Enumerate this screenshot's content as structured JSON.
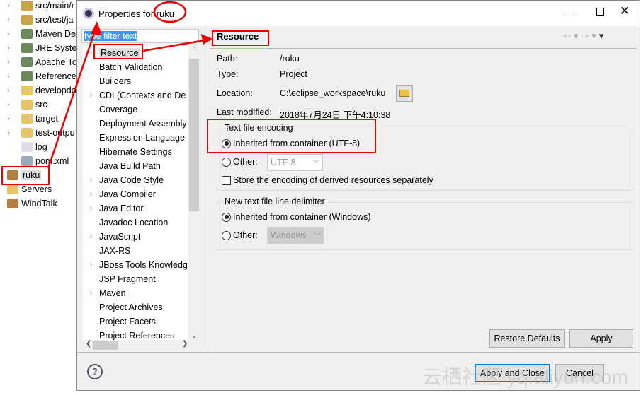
{
  "explorer": {
    "items": [
      {
        "label": "src/main/r",
        "chev": true,
        "icon": "package-folder-icon"
      },
      {
        "label": "src/test/ja",
        "chev": true,
        "icon": "package-folder-icon"
      },
      {
        "label": "Maven De",
        "chev": true,
        "icon": "library-icon"
      },
      {
        "label": "JRE Syster",
        "chev": true,
        "icon": "library-icon"
      },
      {
        "label": "Apache To",
        "chev": true,
        "icon": "library-icon"
      },
      {
        "label": "Reference",
        "chev": true,
        "icon": "library-icon"
      },
      {
        "label": "developdo",
        "chev": true,
        "icon": "folder-icon"
      },
      {
        "label": "src",
        "chev": true,
        "icon": "folder-icon"
      },
      {
        "label": "target",
        "chev": true,
        "icon": "folder-icon"
      },
      {
        "label": "test-outpu",
        "chev": true,
        "icon": "folder-icon"
      },
      {
        "label": "log",
        "chev": false,
        "icon": "file-icon"
      },
      {
        "label": "pom.xml",
        "chev": false,
        "icon": "maven-file-icon"
      }
    ],
    "projects": [
      {
        "label": "ruku",
        "icon": "project-icon"
      },
      {
        "label": "Servers",
        "icon": "folder-icon"
      },
      {
        "label": "WindTalk",
        "icon": "project-icon"
      }
    ]
  },
  "dialog": {
    "title": "Properties for ruku",
    "filter": {
      "value": "type filter text"
    },
    "tree": [
      {
        "label": "Resource",
        "chev": true,
        "selected": true
      },
      {
        "label": "Batch Validation",
        "chev": false
      },
      {
        "label": "Builders",
        "chev": false
      },
      {
        "label": "CDI (Contexts and De",
        "chev": true
      },
      {
        "label": "Coverage",
        "chev": false
      },
      {
        "label": "Deployment Assembly",
        "chev": false
      },
      {
        "label": "Expression Language",
        "chev": false
      },
      {
        "label": "Hibernate Settings",
        "chev": false
      },
      {
        "label": "Java Build Path",
        "chev": false
      },
      {
        "label": "Java Code Style",
        "chev": true
      },
      {
        "label": "Java Compiler",
        "chev": true
      },
      {
        "label": "Java Editor",
        "chev": true
      },
      {
        "label": "Javadoc Location",
        "chev": false
      },
      {
        "label": "JavaScript",
        "chev": true
      },
      {
        "label": "JAX-RS",
        "chev": false
      },
      {
        "label": "JBoss Tools Knowledg",
        "chev": true
      },
      {
        "label": "JSP Fragment",
        "chev": false
      },
      {
        "label": "Maven",
        "chev": true
      },
      {
        "label": "Project Archives",
        "chev": false
      },
      {
        "label": "Project Facets",
        "chev": false
      },
      {
        "label": "Project References",
        "chev": false
      }
    ],
    "page": {
      "heading": "Resource",
      "path_label": "Path:",
      "path": "/ruku",
      "type_label": "Type:",
      "type": "Project",
      "location_label": "Location:",
      "location": "C:\\eclipse_workspace\\ruku",
      "modified_label": "Last modified:",
      "modified": "2018年7月24日 下午4:10:38",
      "encoding": {
        "legend": "Text file encoding",
        "inherited": "Inherited from container (UTF-8)",
        "other": "Other:",
        "other_value": "UTF-8",
        "store": "Store the encoding of derived resources separately",
        "selected": "inherited",
        "store_checked": false
      },
      "delimiter": {
        "legend": "New text file line delimiter",
        "inherited": "Inherited from container (Windows)",
        "other": "Other:",
        "other_value": "Windows",
        "selected": "inherited"
      },
      "restore": "Restore Defaults",
      "apply": "Apply"
    },
    "apply_close": "Apply and Close",
    "cancel": "Cancel"
  },
  "watermark": "云栖社区 yq.aliyun.com",
  "colors": {
    "annotation": "#ee0000",
    "selection": "#3399ff",
    "accent": "#0078d7"
  }
}
